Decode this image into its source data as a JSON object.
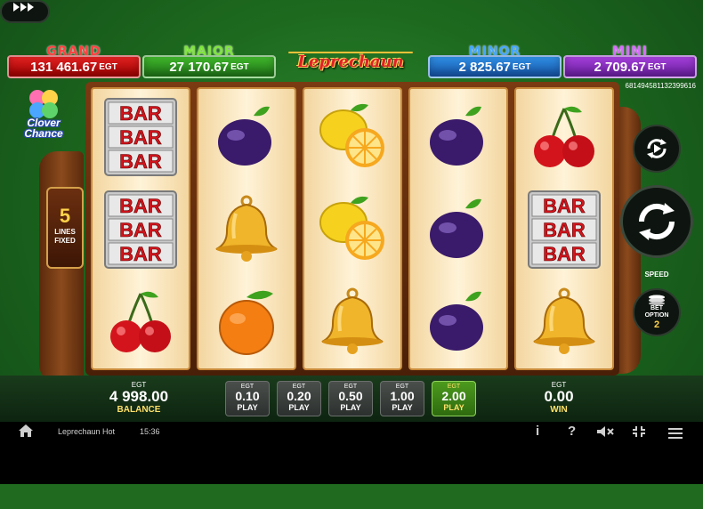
{
  "jackpots": [
    {
      "id": "grand",
      "name": "GRAND",
      "amount": "131 461.67",
      "currency": "EGT",
      "color": "#cc1a1a"
    },
    {
      "id": "major",
      "name": "MAJOR",
      "amount": "27 170.67",
      "currency": "EGT",
      "color": "#2e9a22"
    },
    {
      "id": "minor",
      "name": "MINOR",
      "amount": "2 825.67",
      "currency": "EGT",
      "color": "#2276cc"
    },
    {
      "id": "mini",
      "name": "MINI",
      "amount": "2 709.67",
      "currency": "EGT",
      "color": "#8a2fc0"
    }
  ],
  "game": {
    "logo": "Leprechaun Hot",
    "game_id": "681494581132399616",
    "clover_chance": "Clover Chance"
  },
  "lines": {
    "count": "5",
    "label_1": "LINES",
    "label_2": "FIXED"
  },
  "reels": [
    [
      "bar-triple",
      "bar-triple",
      "cherries"
    ],
    [
      "plum",
      "bell",
      "orange"
    ],
    [
      "lemon",
      "lemon",
      "bell"
    ],
    [
      "plum",
      "plum",
      "plum"
    ],
    [
      "cherries",
      "bar-triple",
      "bell"
    ]
  ],
  "symbols": {
    "bar_text": "BAR"
  },
  "controls": {
    "speed_label": "SPEED",
    "bet_option_label_1": "BET",
    "bet_option_label_2": "OPTION",
    "bet_option_value": "2"
  },
  "panel": {
    "balance": {
      "currency": "EGT",
      "value": "4 998.00",
      "label": "BALANCE"
    },
    "win": {
      "currency": "EGT",
      "value": "0.00",
      "label": "WIN"
    },
    "bets": [
      {
        "currency": "EGT",
        "value": "0.10",
        "label": "PLAY",
        "active": false
      },
      {
        "currency": "EGT",
        "value": "0.20",
        "label": "PLAY",
        "active": false
      },
      {
        "currency": "EGT",
        "value": "0.50",
        "label": "PLAY",
        "active": false
      },
      {
        "currency": "EGT",
        "value": "1.00",
        "label": "PLAY",
        "active": false
      },
      {
        "currency": "EGT",
        "value": "2.00",
        "label": "PLAY",
        "active": true
      }
    ]
  },
  "toolbar": {
    "home_icon": "home-icon",
    "title": "Leprechaun Hot",
    "time": "15:36",
    "info_glyph": "i",
    "help_glyph": "?",
    "icons": [
      "info-icon",
      "help-icon",
      "mute-icon",
      "fullscreen-icon",
      "menu-icon"
    ]
  }
}
